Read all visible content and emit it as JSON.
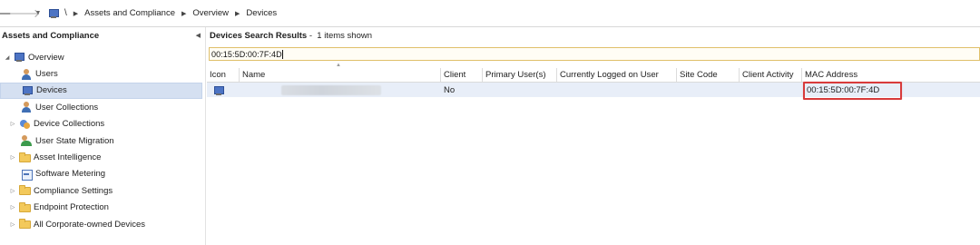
{
  "addressbar": {
    "separator": "\\",
    "breadcrumb": [
      "Assets and Compliance",
      "Overview",
      "Devices"
    ]
  },
  "navpane": {
    "header": "Assets and Compliance",
    "items": [
      {
        "label": "Overview",
        "icon": "computer-icon",
        "expanded": true
      },
      {
        "label": "Users",
        "icon": "user-icon"
      },
      {
        "label": "Devices",
        "icon": "computer-icon",
        "selected": true
      },
      {
        "label": "User Collections",
        "icon": "user-collection-icon"
      },
      {
        "label": "Device Collections",
        "icon": "device-collection-icon"
      },
      {
        "label": "User State Migration",
        "icon": "migration-icon"
      },
      {
        "label": "Asset Intelligence",
        "icon": "folder-icon"
      },
      {
        "label": "Software Metering",
        "icon": "metering-icon"
      },
      {
        "label": "Compliance Settings",
        "icon": "folder-icon"
      },
      {
        "label": "Endpoint Protection",
        "icon": "folder-icon"
      },
      {
        "label": "All Corporate-owned Devices",
        "icon": "folder-icon"
      }
    ]
  },
  "results": {
    "title": "Devices Search Results",
    "count_text": " -  1 items shown",
    "search_value": "00:15:5D:00:7F:4D",
    "columns": [
      "Icon",
      "Name",
      "Client",
      "Primary User(s)",
      "Currently Logged on User",
      "Site Code",
      "Client Activity",
      "MAC Address"
    ],
    "rows": [
      {
        "icon": "computer-icon",
        "name": "",
        "client": "No",
        "primary_users": "",
        "logged_on": "",
        "site_code": "",
        "client_activity": "",
        "mac": "00:15:5D:00:7F:4D"
      }
    ]
  },
  "colors": {
    "selection": "#d5e0f1",
    "row_highlight": "#e8eef8",
    "annotation_box": "#d83b3b",
    "search_border": "#e0c06a"
  }
}
